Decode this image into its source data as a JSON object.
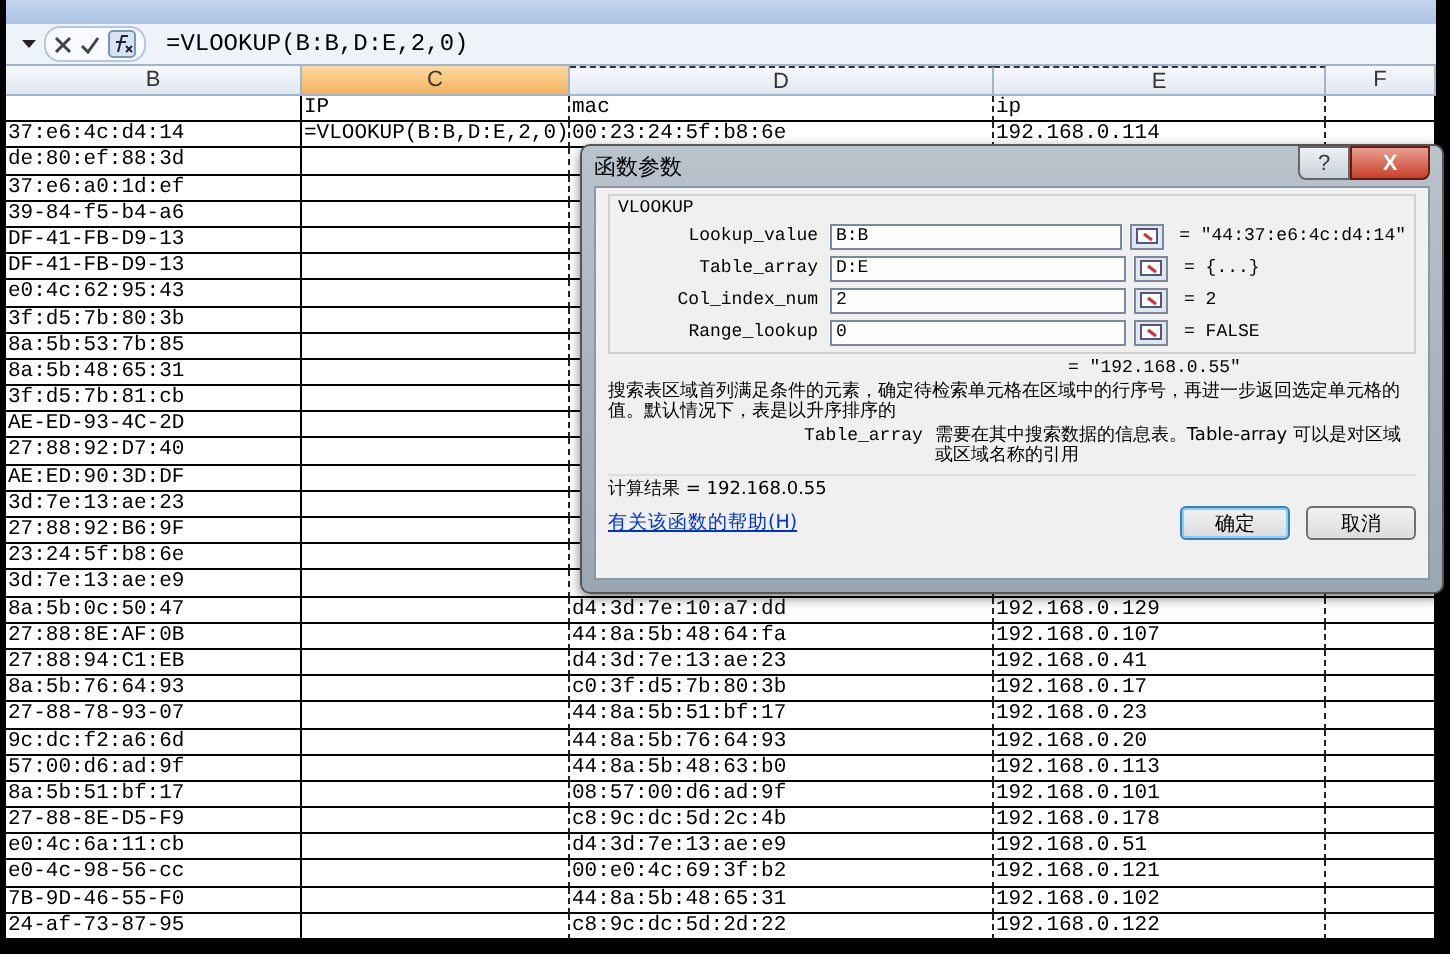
{
  "formula_bar": {
    "formula": "=VLOOKUP(B:B,D:E,2,0)"
  },
  "columns": [
    {
      "label": "B",
      "selected": false,
      "copied": false
    },
    {
      "label": "C",
      "selected": true,
      "copied": false
    },
    {
      "label": "D",
      "selected": false,
      "copied": true
    },
    {
      "label": "E",
      "selected": false,
      "copied": true
    },
    {
      "label": "F",
      "selected": false,
      "copied": false
    }
  ],
  "rows": [
    {
      "c": "IP",
      "d": "mac",
      "e": "ip"
    },
    {
      "b": "37:e6:4c:d4:14",
      "c": "=VLOOKUP(B:B,D:E,2,0)",
      "d": "00:23:24:5f:b8:6e",
      "e": "192.168.0.114"
    },
    {
      "b": "de:80:ef:88:3d"
    },
    {
      "b": "37:e6:a0:1d:ef"
    },
    {
      "b": "39-84-f5-b4-a6"
    },
    {
      "b": "DF-41-FB-D9-13"
    },
    {
      "b": "DF-41-FB-D9-13"
    },
    {
      "b": "e0:4c:62:95:43"
    },
    {
      "b": "3f:d5:7b:80:3b"
    },
    {
      "b": "8a:5b:53:7b:85"
    },
    {
      "b": "8a:5b:48:65:31"
    },
    {
      "b": "3f:d5:7b:81:cb"
    },
    {
      "b": "AE-ED-93-4C-2D"
    },
    {
      "b": "27:88:92:D7:40"
    },
    {
      "b": "AE:ED:90:3D:DF"
    },
    {
      "b": "3d:7e:13:ae:23"
    },
    {
      "b": "27:88:92:B6:9F"
    },
    {
      "b": "23:24:5f:b8:6e"
    },
    {
      "b": "3d:7e:13:ae:e9"
    },
    {
      "b": "8a:5b:0c:50:47",
      "d": "d4:3d:7e:10:a7:dd",
      "e": "192.168.0.129"
    },
    {
      "b": "27:88:8E:AF:0B",
      "d": "44:8a:5b:48:64:fa",
      "e": "192.168.0.107"
    },
    {
      "b": "27:88:94:C1:EB",
      "d": "d4:3d:7e:13:ae:23",
      "e": "192.168.0.41"
    },
    {
      "b": "8a:5b:76:64:93",
      "d": "c0:3f:d5:7b:80:3b",
      "e": "192.168.0.17"
    },
    {
      "b": "27-88-78-93-07",
      "d": "44:8a:5b:51:bf:17",
      "e": "192.168.0.23"
    },
    {
      "b": "9c:dc:f2:a6:6d",
      "d": "44:8a:5b:76:64:93",
      "e": "192.168.0.20"
    },
    {
      "b": "57:00:d6:ad:9f",
      "d": "44:8a:5b:48:63:b0",
      "e": "192.168.0.113"
    },
    {
      "b": "8a:5b:51:bf:17",
      "d": "08:57:00:d6:ad:9f",
      "e": "192.168.0.101"
    },
    {
      "b": "27-88-8E-D5-F9",
      "d": "c8:9c:dc:5d:2c:4b",
      "e": "192.168.0.178"
    },
    {
      "b": "e0:4c:6a:11:cb",
      "d": "d4:3d:7e:13:ae:e9",
      "e": "192.168.0.51"
    },
    {
      "b": "e0-4c-98-56-cc",
      "d": "00:e0:4c:69:3f:b2",
      "e": "192.168.0.121"
    },
    {
      "b": "7B-9D-46-55-F0",
      "d": "44:8a:5b:48:65:31",
      "e": "192.168.0.102"
    },
    {
      "b": "24-af-73-87-95",
      "d": "c8:9c:dc:5d:2d:22",
      "e": "192.168.0.122"
    }
  ],
  "dialog": {
    "title": "函数参数",
    "help": "?",
    "close": "X",
    "function": "VLOOKUP",
    "args": [
      {
        "label": "Lookup_value",
        "value": "B:B",
        "result": "= \"44:37:e6:4c:d4:14\""
      },
      {
        "label": "Table_array",
        "value": "D:E",
        "result": "= {...}"
      },
      {
        "label": "Col_index_num",
        "value": "2",
        "result": "= 2"
      },
      {
        "label": "Range_lookup",
        "value": "0",
        "result": "= FALSE"
      }
    ],
    "formula_result": "= \"192.168.0.55\"",
    "description": "搜索表区域首列满足条件的元素，确定待检索单元格在区域中的行序号，再进一步返回选定单元格的值。默认情况下，表是以升序排序的",
    "arg_name": "Table_array",
    "arg_help": "需要在其中搜索数据的信息表。Table-array 可以是对区域或区域名称的引用",
    "result_text": "计算结果 = 192.168.0.55",
    "help_link": "有关该函数的帮助(H)",
    "buttons": [
      {
        "label": "确定",
        "kind": "default"
      },
      {
        "label": "取消",
        "kind": "normal"
      }
    ]
  }
}
